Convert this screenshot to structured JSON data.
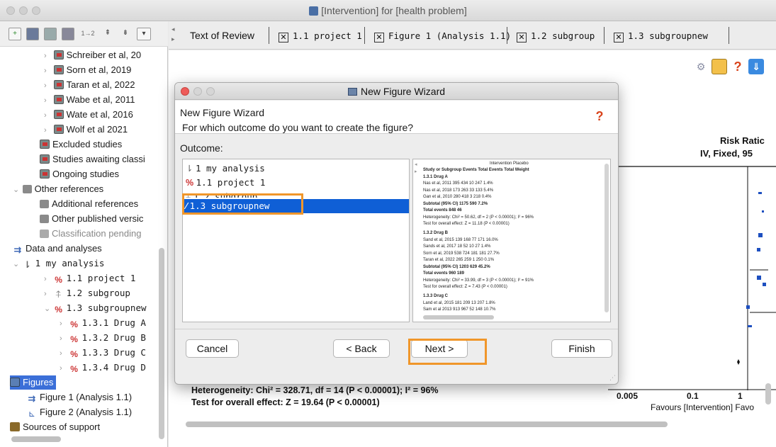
{
  "window": {
    "title": "[Intervention] for [health problem]"
  },
  "left_toolbar": {
    "icons": [
      "add-study-icon",
      "doc-icon",
      "doc-gray-icon",
      "doc-edit-icon",
      "sort-icon",
      "move-up-icon",
      "move-down-icon",
      "dropdown-icon"
    ],
    "sort_label": "1→2"
  },
  "tree": {
    "studies": [
      "Schreiber et al, 20",
      "Sorn et al, 2019",
      "Taran et al, 2022",
      "Wabe et al, 2011",
      "Wate et al, 2016",
      "Wolf et al 2021"
    ],
    "excluded": "Excluded studies",
    "awaiting": "Studies awaiting classi",
    "ongoing": "Ongoing studies",
    "other_refs": "Other references",
    "additional": "Additional references",
    "other_published": "Other published versic",
    "classification": "Classification pending",
    "data_analyses": "Data and analyses",
    "my_analysis": "1 my analysis",
    "project": "1.1 project 1",
    "subgroup": "1.2 subgroup",
    "subgroupnew": "1.3 subgroupnew",
    "drugs": [
      "1.3.1 Drug A",
      "1.3.2 Drug B",
      "1.3.3 Drug C",
      "1.3.4 Drug D"
    ],
    "figures": "Figures",
    "figure1": "Figure 1 (Analysis 1.1)",
    "figure2": "Figure 2 (Analysis 1.1)",
    "sources": "Sources of support"
  },
  "tabs": [
    "Text of Review",
    "1.1 project 1",
    "Figure 1 (Analysis 1.1)",
    "1.2 subgroup",
    "1.3 subgroupnew"
  ],
  "background": {
    "risk_ratio": "Risk Ratic",
    "risk_sub": "IV, Fixed, 95",
    "heterogeneity": "Heterogeneity: Chi² = 328.71, df = 14 (P < 0.00001); I² = 96%",
    "overall": "Test for overall effect: Z = 19.64 (P < 0.00001)",
    "tick1": "0.005",
    "tick2": "0.1",
    "tick3": "1",
    "favours": "Favours [Intervention]  Favo"
  },
  "dialog": {
    "title": "New Figure Wizard",
    "header": "New Figure Wizard",
    "question": "For which outcome do you want to create the figure?",
    "outcome_label": "Outcome:",
    "items": [
      "1 my analysis",
      "1.1 project 1",
      "1.2 subgroup",
      "1.3 subgroupnew"
    ],
    "selected_index": 3,
    "buttons": {
      "cancel": "Cancel",
      "back": "< Back",
      "next": "Next >",
      "finish": "Finish"
    },
    "preview": [
      "Study or Subgroup      Events  Total  Events  Total  Weight",
      "1.3.1 Drug A",
      "Nas et al, 2011         395     434     10     247    1.4%",
      "Nas et al, 2018         173     263     33     133    5.4%",
      "Gan et al, 2010         280     418      3     218    0.4%",
      "Subtotal (95% CI)               1175            590    7.2%",
      "Total events            848             46",
      "Heterogeneity: Chi² = 50.62, df = 2 (P < 0.00001); I² = 96%",
      "Test for overall effect: Z = 11.18 (P < 0.00001)",
      "1.3.2 Drug B",
      "Sand et al, 2015        139     168     77     171   16.0%",
      "Sands et al, 2017        18      52     10      27    1.4%",
      "Sorn et al, 2019        538     724    181     181   27.7%",
      "Taran et al, 2022       265     259      1     250    0.1%",
      "Subtotal (95% CI)               1203            629   45.2%",
      "Total events            960            189",
      "Heterogeneity: Chi² = 33.99, df = 3 (P < 0.00001); I² = 91%",
      "Test for overall effect: Z = 7.43 (P < 0.00001)",
      "1.3.3 Drug C",
      "Land et al, 2015        181     209     13     207    1.8%",
      "Sam et al 2013          913     967     52     148   10.7%"
    ],
    "preview_header": "Intervention      Placebo"
  }
}
